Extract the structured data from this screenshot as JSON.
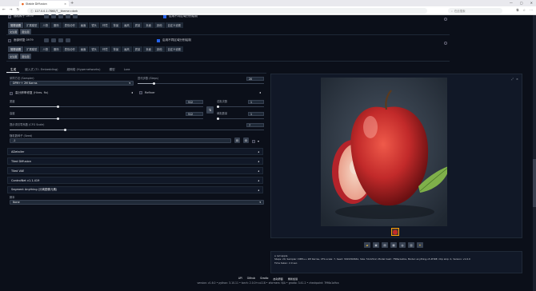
{
  "browser": {
    "tab_title": "Stable Diffusion",
    "url": "127.0.0.1:7860/?__theme=dark",
    "search_placeholder": "在此搜索"
  },
  "extras": {
    "top_checkbox_label": "随机种子 0979",
    "top_right_label": "启用不同区域分别绘制",
    "row2_checkbox_label": "面部修复 0979",
    "row2_right_label": "启用不同区域分别绘制",
    "tabs1": [
      "常规设置",
      "扩展模型",
      "人物",
      "服饰",
      "表情动作",
      "画面",
      "镜头",
      "环境",
      "背景",
      "画风",
      "质量",
      "负面",
      "其他",
      "自定义设置"
    ],
    "tabs2": [
      "常规设置",
      "扩展模型",
      "人物",
      "服饰",
      "表情动作",
      "画面",
      "镜头",
      "环境",
      "背景",
      "画风",
      "质量",
      "负面",
      "其他",
      "自定义设置"
    ],
    "small_btns1": [
      "文生图",
      "图生图"
    ],
    "small_btns2": [
      "文生图",
      "图生图"
    ]
  },
  "main_tabs": {
    "items": [
      "生成",
      "嵌入式 (T.I. Embedding)",
      "超网络 (Hypernetworks)",
      "模型",
      "Lora"
    ],
    "active": "生成"
  },
  "params": {
    "sampler_label": "采样方法 (Sampler)",
    "sampler_value": "DPM++ 2M Karras",
    "steps_label": "迭代步数 (Steps)",
    "steps_value": "20",
    "steps_fraction": 0.13,
    "hires_label": "高分辨率修复 (Hires. fix)",
    "refiner_label": "Refiner",
    "width_label": "宽度",
    "width_value": "512",
    "width_fraction": 0.25,
    "height_label": "高度",
    "height_value": "512",
    "height_fraction": 0.25,
    "batch_count_label": "总批次数",
    "batch_count_value": "1",
    "batch_size_label": "单批数量",
    "batch_size_value": "1",
    "cfg_label": "提示词引导系数 (CFG Scale)",
    "cfg_value": "7",
    "cfg_fraction": 0.22,
    "seed_label": "随机数种子 (Seed)",
    "seed_value": "-1"
  },
  "accordions": [
    "ADetailer",
    "Tiled Diffusion",
    "Tiled VAE",
    "ControlNet v1.1.419",
    "Segment Anything (分离图像元素)"
  ],
  "script": {
    "label": "脚本",
    "value": "None"
  },
  "gallery": {
    "caption": "a red apple",
    "params_text": "Steps: 20, Sampler: DPM++ 2M Karras, CFG scale: 7, Seed: 3019360661, Size: 512x512, Model hash: 7f96a1a9ca, Model: anything-v5-PrtRE, Clip skip: 2, Version: v1.6.0",
    "time_text": "Time taken: 2.0 sec."
  },
  "footer": {
    "links": [
      "API",
      "Github",
      "Gradio",
      "启动界面",
      "重新加载"
    ],
    "versions": "version: v1.6.0  •  python: 3.10.11  •  torch: 2.0.0+cu118  •  xformers: N/A  •  gradio: 3.41.2  •  checkpoint: 7f96a1a9ca"
  },
  "colors": {
    "app_bg": "#0b0f19",
    "panel_bg": "#111827",
    "accent": "#2563eb",
    "apple_red": "#c22a2a"
  }
}
